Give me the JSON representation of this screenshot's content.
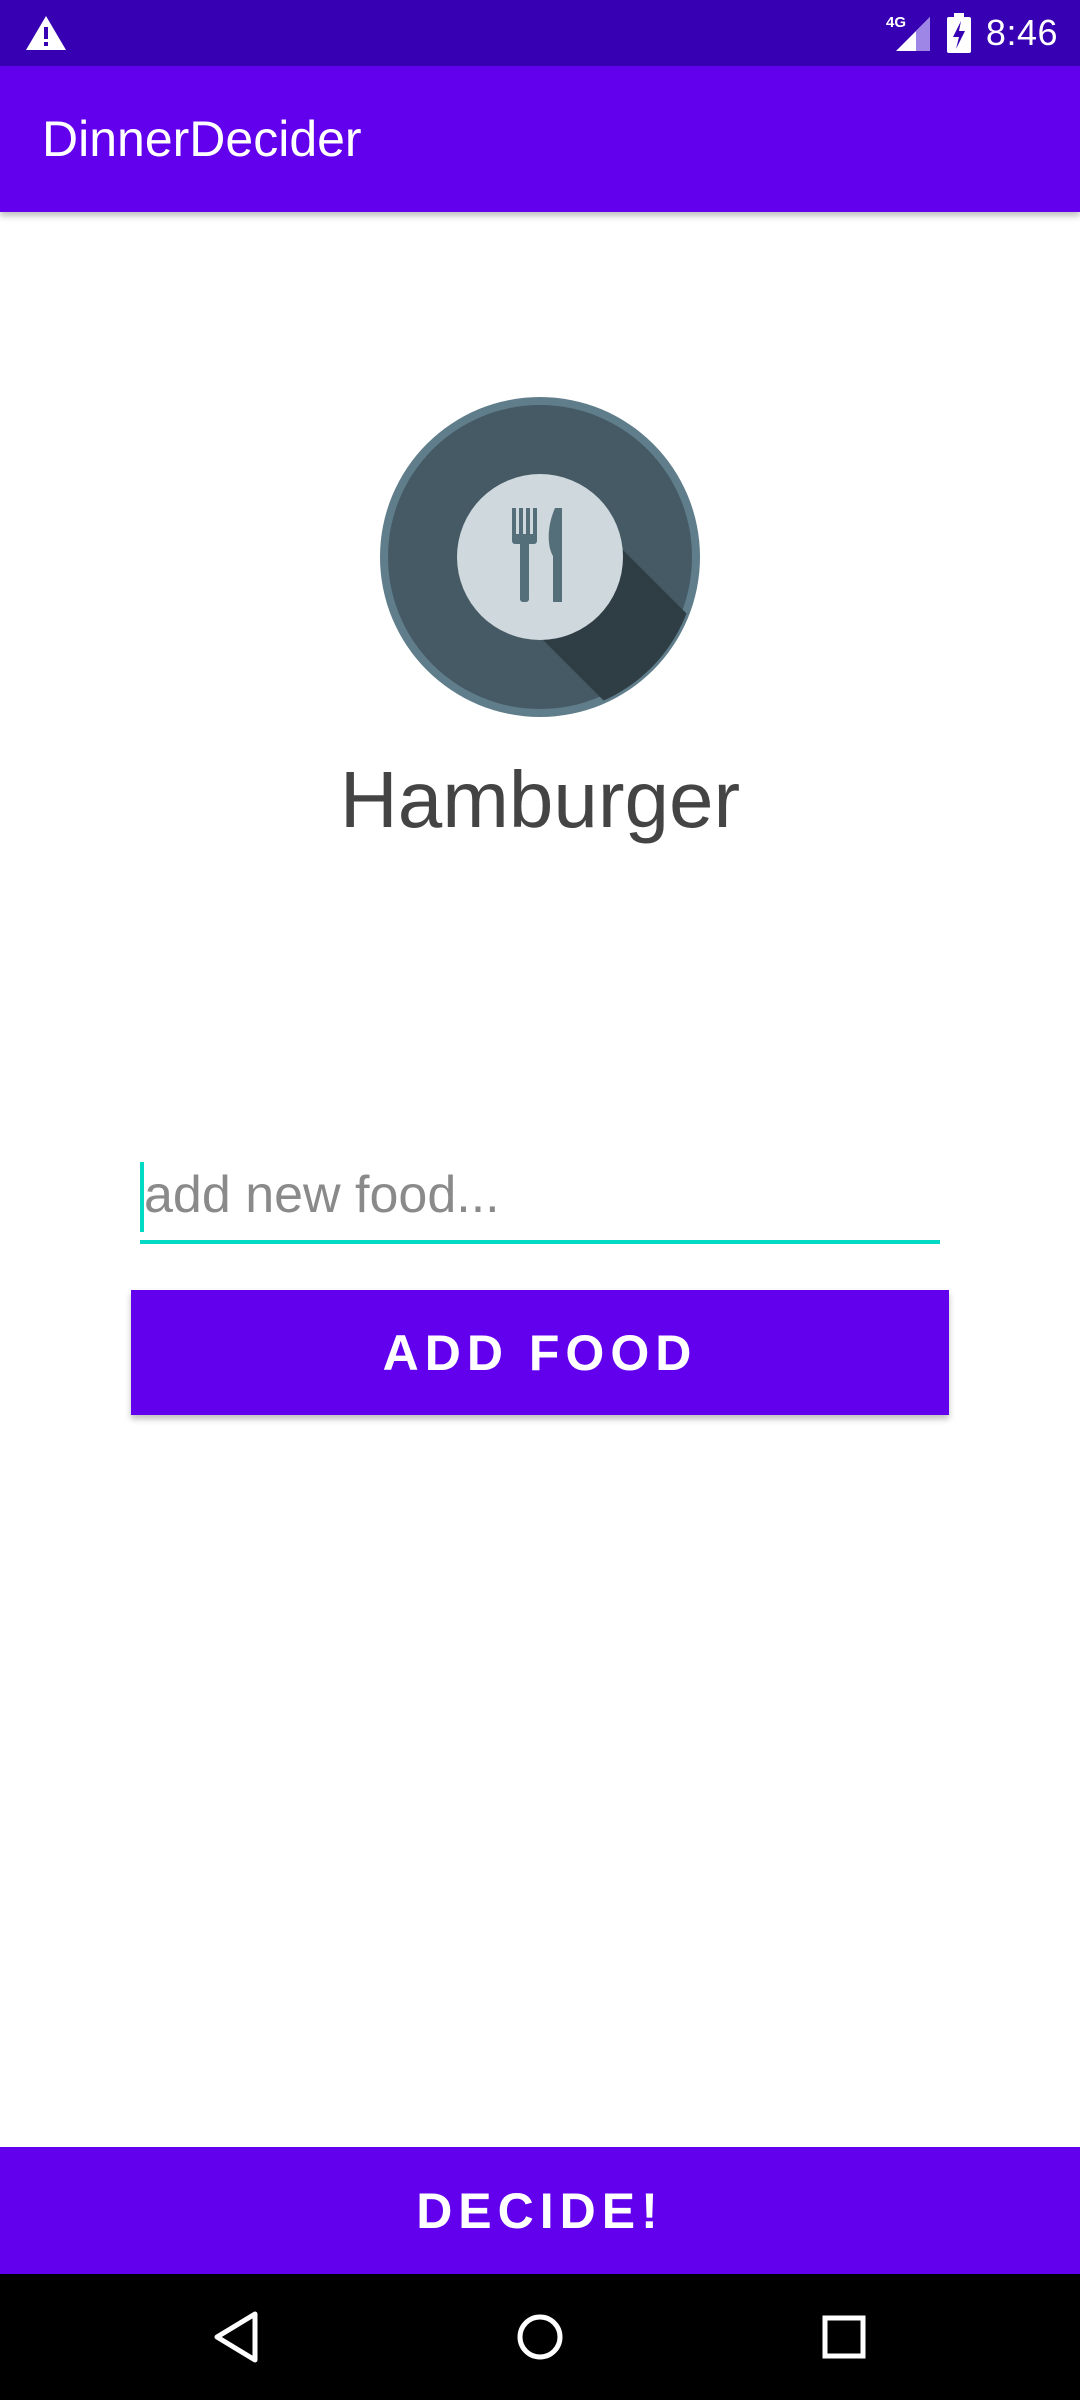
{
  "status_bar": {
    "time": "8:46",
    "network": "4G",
    "icons": [
      "warning-icon",
      "signal-icon",
      "battery-charging-icon"
    ]
  },
  "app_bar": {
    "title": "DinnerDecider"
  },
  "main": {
    "plate_icon": "plate-fork-knife-icon",
    "selected_food": "Hamburger",
    "input": {
      "value": "",
      "placeholder": "add new food..."
    },
    "add_button_label": "ADD FOOD",
    "decide_button_label": "DECIDE!"
  },
  "nav_bar": {
    "icons": [
      "back-icon",
      "home-icon",
      "recents-icon"
    ]
  },
  "colors": {
    "status_bar": "#3700b3",
    "primary": "#6200ee",
    "accent": "#03dac5",
    "plate_outer": "#455a64",
    "plate_inner": "#cfd8dc"
  }
}
